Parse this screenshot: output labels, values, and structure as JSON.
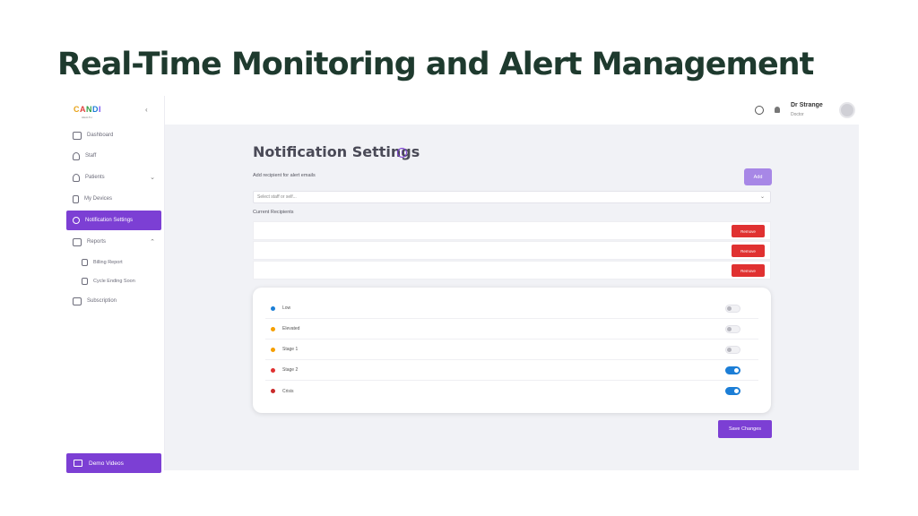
{
  "slide": {
    "title": "Real-Time Monitoring and Alert Management"
  },
  "app": {
    "logo": {
      "c1": "C",
      "c2": "A",
      "c3": "N",
      "c4": "D",
      "c5": "I",
      "sub": "HEALTH"
    },
    "sidebar": {
      "items": [
        {
          "label": "Dashboard"
        },
        {
          "label": "Staff"
        },
        {
          "label": "Patients"
        },
        {
          "label": "My Devices"
        },
        {
          "label": "Notification Settings"
        },
        {
          "label": "Reports"
        },
        {
          "label": "Billing Report"
        },
        {
          "label": "Cycle Ending Soon"
        },
        {
          "label": "Subscription"
        }
      ],
      "demo_label": "Demo Videos"
    },
    "topbar": {
      "user_name": "Dr Strange",
      "user_role": "Doctor"
    },
    "notification": {
      "title": "Notification Settings",
      "info_glyph": "i",
      "add_label": "Add recipient for alert emails",
      "add_button": "Add",
      "select_placeholder": "Select staff or self...",
      "current_label": "Current Recipients",
      "remove_label": "Remove",
      "alerts": [
        {
          "label": "Low",
          "color": "#1c7ed6",
          "enabled": false
        },
        {
          "label": "Elevated",
          "color": "#f59f00",
          "enabled": false
        },
        {
          "label": "Stage 1",
          "color": "#f59f00",
          "enabled": false
        },
        {
          "label": "Stage 2",
          "color": "#e03131",
          "enabled": true
        },
        {
          "label": "Crisis",
          "color": "#c92a2a",
          "enabled": true
        }
      ],
      "save_button": "Save Changes"
    }
  }
}
